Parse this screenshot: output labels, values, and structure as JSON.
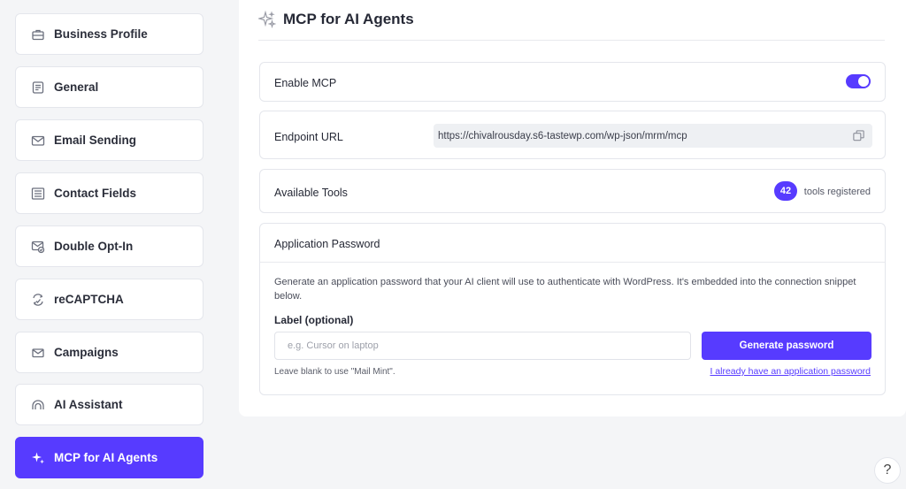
{
  "sidebar": {
    "items": [
      {
        "label": "Business Profile",
        "icon": "briefcase-icon"
      },
      {
        "label": "General",
        "icon": "document-icon"
      },
      {
        "label": "Email Sending",
        "icon": "envelope-icon"
      },
      {
        "label": "Contact Fields",
        "icon": "form-fields-icon"
      },
      {
        "label": "Double Opt-In",
        "icon": "envelope-check-icon"
      },
      {
        "label": "reCAPTCHA",
        "icon": "recaptcha-icon"
      },
      {
        "label": "Campaigns",
        "icon": "mail-icon"
      },
      {
        "label": "AI Assistant",
        "icon": "ai-arc-icon"
      },
      {
        "label": "MCP for AI Agents",
        "icon": "sparkle-icon",
        "active": true
      }
    ]
  },
  "header": {
    "title": "MCP for AI Agents",
    "icon": "sparkle-icon"
  },
  "enable_mcp": {
    "label": "Enable MCP",
    "enabled": true
  },
  "endpoint": {
    "label": "Endpoint URL",
    "url": "https://chivalrousday.s6-tastewp.com/wp-json/mrm/mcp"
  },
  "tools": {
    "label": "Available Tools",
    "count": "42",
    "suffix": "tools registered"
  },
  "app_password": {
    "title": "Application Password",
    "description": "Generate an application password that your AI client will use to authenticate with WordPress. It's embedded into the connection snippet below.",
    "field_label": "Label (optional)",
    "placeholder": "e.g. Cursor on laptop",
    "button": "Generate password",
    "hint": "Leave blank to use \"Mail Mint\".",
    "link": "I already have an application password"
  },
  "help": {
    "label": "?"
  },
  "colors": {
    "accent": "#573bff",
    "background": "#f4f5f7"
  }
}
